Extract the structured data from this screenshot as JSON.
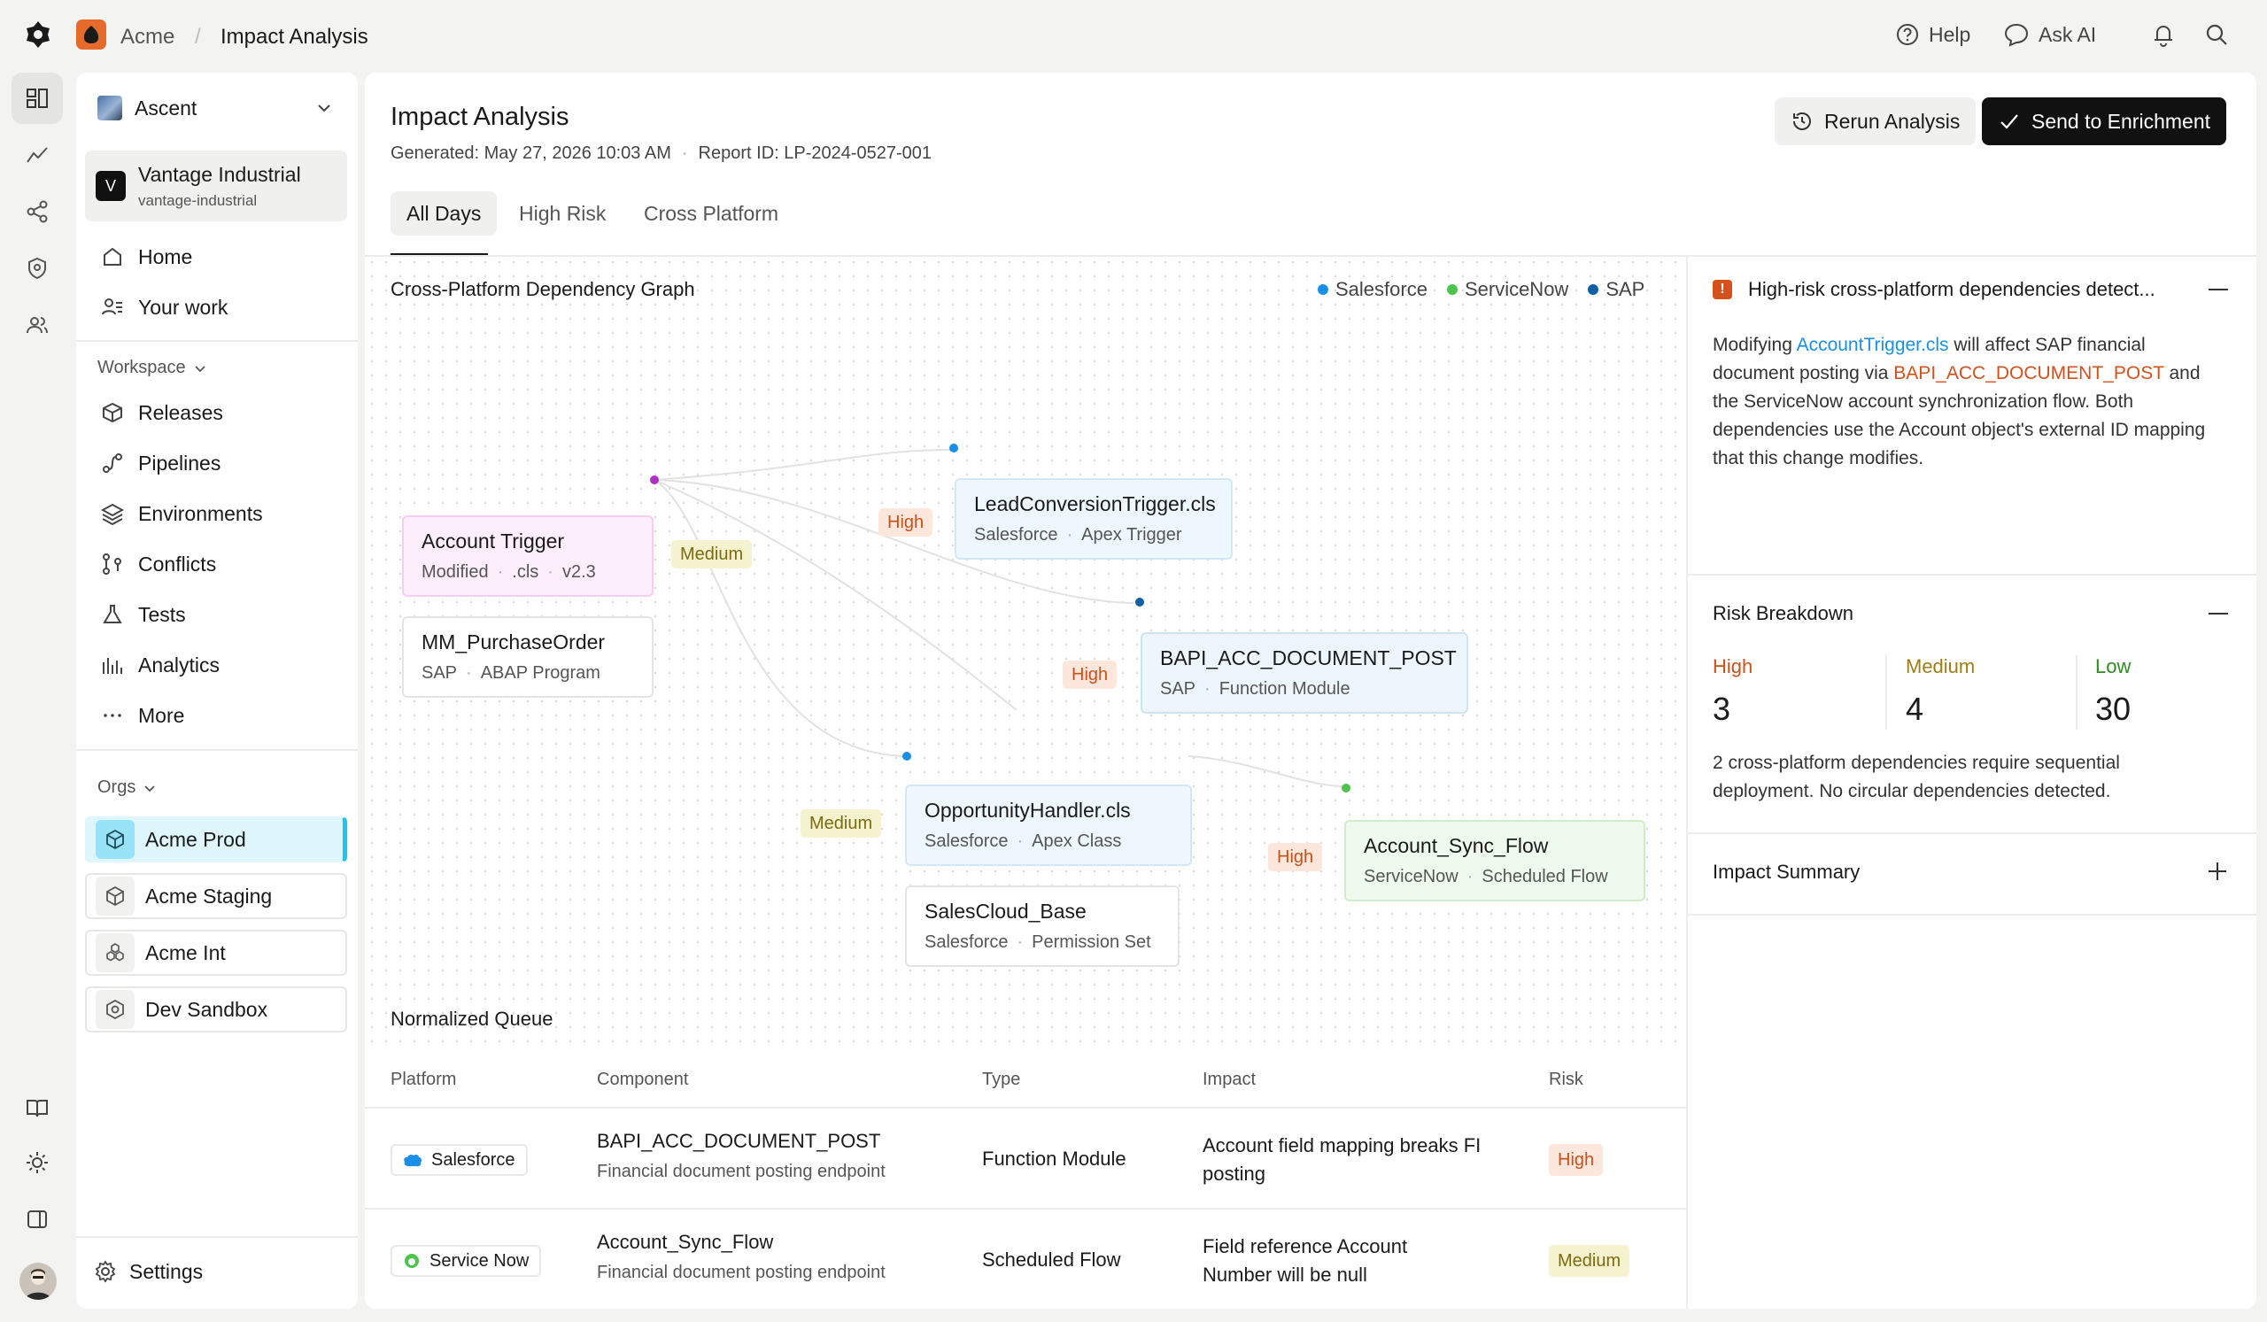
{
  "breadcrumb": {
    "org": "Acme",
    "page": "Impact Analysis"
  },
  "topbar": {
    "help": "Help",
    "ask_ai": "Ask AI"
  },
  "sidebar": {
    "workspace_selector": "Ascent",
    "account": {
      "initial": "V",
      "name": "Vantage Industrial",
      "slug": "vantage-industrial"
    },
    "nav": [
      {
        "label": "Home",
        "icon": "home-icon"
      },
      {
        "label": "Your work",
        "icon": "user-list-icon"
      }
    ],
    "workspace_heading": "Workspace",
    "workspace_items": [
      {
        "label": "Releases",
        "icon": "box-icon"
      },
      {
        "label": "Pipelines",
        "icon": "pipeline-icon"
      },
      {
        "label": "Environments",
        "icon": "layers-icon"
      },
      {
        "label": "Conflicts",
        "icon": "merge-icon"
      },
      {
        "label": "Tests",
        "icon": "flask-icon"
      },
      {
        "label": "Analytics",
        "icon": "bar-chart-icon"
      },
      {
        "label": "More",
        "icon": "ellipsis-icon"
      }
    ],
    "orgs_heading": "Orgs",
    "orgs": [
      {
        "label": "Acme Prod",
        "active": true
      },
      {
        "label": "Acme Staging",
        "active": false
      },
      {
        "label": "Acme Int",
        "active": false
      },
      {
        "label": "Dev Sandbox",
        "active": false
      }
    ],
    "settings": "Settings"
  },
  "header": {
    "title": "Impact Analysis",
    "generated": "Generated: May 27, 2026 10:03 AM",
    "report_id": "Report ID: LP-2024-0527-001",
    "rerun": "Rerun Analysis",
    "send": "Send to Enrichment"
  },
  "tabs": [
    {
      "label": "All Days",
      "active": true
    },
    {
      "label": "High Risk",
      "active": false
    },
    {
      "label": "Cross Platform",
      "active": false
    }
  ],
  "graph": {
    "title": "Cross-Platform Dependency Graph",
    "legend": [
      {
        "label": "Salesforce",
        "color": "#1b8fe6"
      },
      {
        "label": "ServiceNow",
        "color": "#4cc34a"
      },
      {
        "label": "SAP",
        "color": "#0f5fa8"
      }
    ],
    "nodes": [
      {
        "name": "Account Trigger",
        "meta": [
          "Modified",
          ".cls",
          "v2.3"
        ]
      },
      {
        "name": "MM_PurchaseOrder",
        "meta": [
          "SAP",
          "ABAP Program"
        ]
      },
      {
        "name": "LeadConversionTrigger.cls",
        "meta": [
          "Salesforce",
          "Apex Trigger"
        ]
      },
      {
        "name": "BAPI_ACC_DOCUMENT_POST",
        "meta": [
          "SAP",
          "Function Module"
        ]
      },
      {
        "name": "OpportunityHandler.cls",
        "meta": [
          "Salesforce",
          "Apex Class"
        ]
      },
      {
        "name": "SalesCloud_Base",
        "meta": [
          "Salesforce",
          "Permission Set"
        ]
      },
      {
        "name": "Account_Sync_Flow",
        "meta": [
          "ServiceNow",
          "Scheduled Flow"
        ]
      }
    ],
    "edge_labels": [
      "Medium",
      "High",
      "High",
      "Medium",
      "High"
    ]
  },
  "alert": {
    "title": "High-risk cross-platform dependencies detect...",
    "body": {
      "t1": "Modifying ",
      "link1": "AccountTrigger.cls",
      "t2": " will affect SAP financial document posting via ",
      "link2": "BAPI_ACC_DOCUMENT_POST",
      "t3": " and the ServiceNow account synchronization flow. Both dependencies use the Account object's external ID mapping that this change modifies."
    }
  },
  "risk": {
    "title": "Risk Breakdown",
    "items": [
      {
        "label": "High",
        "value": "3",
        "color": "#c8521b"
      },
      {
        "label": "Medium",
        "value": "4",
        "color": "#a07d10"
      },
      {
        "label": "Low",
        "value": "30",
        "color": "#2f8a22"
      }
    ],
    "note": "2 cross-platform dependencies require sequential deployment. No circular dependencies detected."
  },
  "impact_summary": {
    "title": "Impact Summary"
  },
  "queue": {
    "title": "Normalized Queue",
    "headers": [
      "Platform",
      "Component",
      "Type",
      "Impact",
      "Risk"
    ],
    "rows": [
      {
        "platform": "Salesforce",
        "component": "BAPI_ACC_DOCUMENT_POST",
        "desc": "Financial document posting endpoint",
        "type": "Function Module",
        "impact_l1": "Account field mapping breaks FI",
        "impact_l2": "posting",
        "risk": "High"
      },
      {
        "platform": "Service Now",
        "component": "Account_Sync_Flow",
        "desc": "Financial document posting endpoint",
        "type": "Scheduled Flow",
        "impact_l1": "Field reference Account",
        "impact_l2": "Number will be null",
        "risk": "Medium"
      }
    ]
  }
}
